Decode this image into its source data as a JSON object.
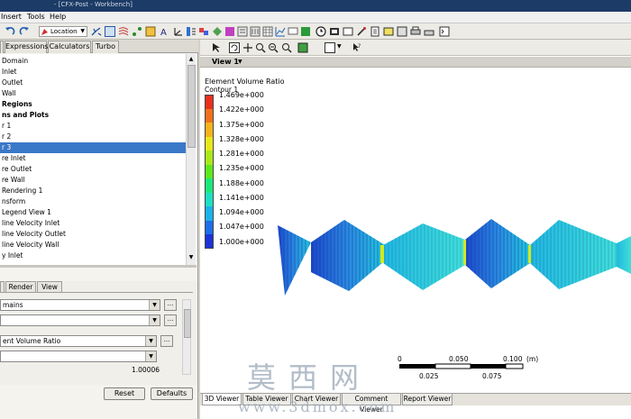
{
  "window": {
    "title_fragment": "- [CFX-Post - Workbench]"
  },
  "menu": {
    "items": [
      "Insert",
      "Tools",
      "Help"
    ]
  },
  "toolbar": {
    "location_label": "Location"
  },
  "left_tabs": [
    "Expressions",
    "Calculators",
    "Turbo"
  ],
  "tree": {
    "items": [
      {
        "label": "Domain",
        "bold": false,
        "selected": false
      },
      {
        "label": "Inlet",
        "bold": false,
        "selected": false
      },
      {
        "label": "Outlet",
        "bold": false,
        "selected": false
      },
      {
        "label": "Wall",
        "bold": false,
        "selected": false
      },
      {
        "label": "Regions",
        "bold": true,
        "selected": false
      },
      {
        "label": "ns and Plots",
        "bold": true,
        "selected": false
      },
      {
        "label": "r 1",
        "bold": false,
        "selected": false
      },
      {
        "label": "r 2",
        "bold": false,
        "selected": false
      },
      {
        "label": "r 3",
        "bold": false,
        "selected": true
      },
      {
        "label": "re Inlet",
        "bold": false,
        "selected": false
      },
      {
        "label": "re Outlet",
        "bold": false,
        "selected": false
      },
      {
        "label": "re Wall",
        "bold": false,
        "selected": false
      },
      {
        "label": "Rendering 1",
        "bold": false,
        "selected": false
      },
      {
        "label": "nsform",
        "bold": false,
        "selected": false
      },
      {
        "label": "Legend View 1",
        "bold": false,
        "selected": false
      },
      {
        "label": "line Velocity Inlet",
        "bold": false,
        "selected": false
      },
      {
        "label": "line Velocity Outlet",
        "bold": false,
        "selected": false
      },
      {
        "label": "line Velocity Wall",
        "bold": false,
        "selected": false
      },
      {
        "label": "y Inlet",
        "bold": false,
        "selected": false
      }
    ]
  },
  "details": {
    "tabs": [
      "Render",
      "View"
    ],
    "domains_value": "mains",
    "variable_value": "ent Volume Ratio",
    "number_value": "1.00006",
    "reset_label": "Reset",
    "defaults_label": "Defaults"
  },
  "viewer": {
    "view_title": "View 1",
    "legend_title": "Element Volume Ratio",
    "legend_subtitle": "Contour 1",
    "legend_labels": [
      "1.469e+000",
      "1.422e+000",
      "1.375e+000",
      "1.328e+000",
      "1.281e+000",
      "1.235e+000",
      "1.188e+000",
      "1.141e+000",
      "1.094e+000",
      "1.047e+000",
      "1.000e+000"
    ],
    "legend_colors": [
      "#e8311c",
      "#f2701c",
      "#f5b21c",
      "#e8e81c",
      "#a9e81c",
      "#5fe81c",
      "#1ce87a",
      "#1cdfc4",
      "#1cb2e8",
      "#1c6fe8",
      "#1c33d6"
    ],
    "scale": {
      "top_labels": [
        "0",
        "0.050",
        "0.100"
      ],
      "bottom_labels": [
        "0.025",
        "0.075"
      ],
      "unit": "(m)"
    }
  },
  "bottom_tabs": [
    "3D Viewer",
    "Table Viewer",
    "Chart Viewer",
    "Comment Viewer",
    "Report Viewer"
  ],
  "watermark": {
    "cn": "莫西网",
    "url": "www.3dmox.com"
  },
  "colors": {
    "selection": "#3a78c8",
    "title_bar": "#1c3b66",
    "mesh_cyan": "#22c6dc",
    "mesh_blue": "#1c5ad6"
  }
}
